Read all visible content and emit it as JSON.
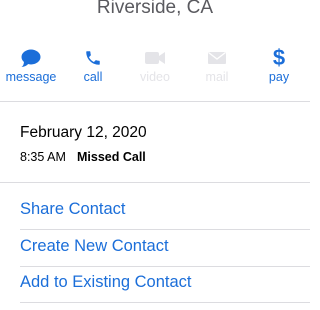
{
  "contact": {
    "location": "Riverside, CA"
  },
  "actions": [
    {
      "label": "message",
      "icon": "message-icon",
      "enabled": true
    },
    {
      "label": "call",
      "icon": "phone-icon",
      "enabled": true
    },
    {
      "label": "video",
      "icon": "video-icon",
      "enabled": false
    },
    {
      "label": "mail",
      "icon": "mail-icon",
      "enabled": false
    },
    {
      "label": "pay",
      "icon": "dollar-icon",
      "enabled": true
    }
  ],
  "call_info": {
    "date": "February 12, 2020",
    "time": "8:35 AM",
    "status": "Missed Call"
  },
  "links": {
    "share": "Share Contact",
    "create": "Create New Contact",
    "add": "Add to Existing Contact"
  },
  "colors": {
    "accent": "#1b6ed9",
    "disabled": "#e4e4e8",
    "separator": "#dcdce0"
  }
}
